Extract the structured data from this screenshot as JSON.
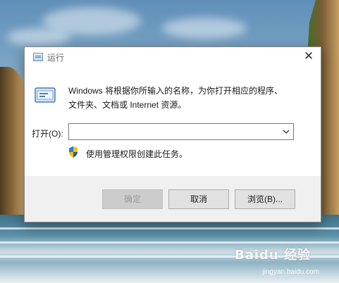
{
  "dialog": {
    "title": "运行",
    "description_line1": "Windows 将根据你所输入的名称，为你打开相应的程序、",
    "description_line2": "文件夹、文档或 Internet 资源。",
    "open_label": "打开(O):",
    "open_value": "",
    "admin_note": "使用管理权限创建此任务。",
    "buttons": {
      "ok": "确定",
      "cancel": "取消",
      "browse": "浏览(B)..."
    },
    "close_glyph": "✕"
  },
  "watermark": {
    "logo": "Baidu 经验",
    "url": "jingyan.baidu.com"
  },
  "icons": [
    "run-icon",
    "close-icon",
    "chevron-down-icon",
    "uac-shield-icon"
  ],
  "colors": {
    "accent": "#0078d7",
    "disabled_text": "#9a9a9a",
    "footer_bg": "#f0f0f0"
  }
}
